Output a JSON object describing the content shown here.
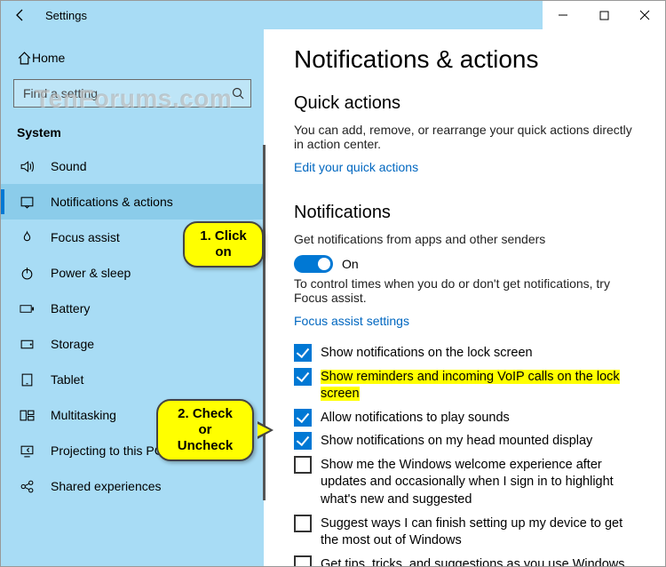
{
  "window": {
    "title": "Settings",
    "watermark": "TenForums.com"
  },
  "sidebar": {
    "home": "Home",
    "search_placeholder": "Find a setting",
    "section": "System",
    "items": [
      {
        "icon": "sound-icon",
        "label": "Sound"
      },
      {
        "icon": "notification-icon",
        "label": "Notifications & actions",
        "selected": true
      },
      {
        "icon": "focus-assist-icon",
        "label": "Focus assist"
      },
      {
        "icon": "power-icon",
        "label": "Power & sleep"
      },
      {
        "icon": "battery-icon",
        "label": "Battery"
      },
      {
        "icon": "storage-icon",
        "label": "Storage"
      },
      {
        "icon": "tablet-icon",
        "label": "Tablet"
      },
      {
        "icon": "multitasking-icon",
        "label": "Multitasking"
      },
      {
        "icon": "projecting-icon",
        "label": "Projecting to this PC"
      },
      {
        "icon": "shared-icon",
        "label": "Shared experiences"
      }
    ]
  },
  "content": {
    "h1": "Notifications & actions",
    "quick_h2": "Quick actions",
    "quick_desc": "You can add, remove, or rearrange your quick actions directly in action center.",
    "quick_link": "Edit your quick actions",
    "notif_h2": "Notifications",
    "notif_desc": "Get notifications from apps and other senders",
    "toggle_label": "On",
    "focus_note": "To control times when you do or don't get notifications, try Focus assist.",
    "focus_link": "Focus assist settings",
    "checks": [
      {
        "checked": true,
        "label": "Show notifications on the lock screen"
      },
      {
        "checked": true,
        "label": "Show reminders and incoming VoIP calls on the lock screen",
        "highlight": true
      },
      {
        "checked": true,
        "label": "Allow notifications to play sounds"
      },
      {
        "checked": true,
        "label": "Show notifications on my head mounted display"
      },
      {
        "checked": false,
        "label": "Show me the Windows welcome experience after updates and occasionally when I sign in to highlight what's new and suggested"
      },
      {
        "checked": false,
        "label": "Suggest ways I can finish setting up my device to get the most out of Windows"
      },
      {
        "checked": false,
        "label": "Get tips, tricks, and suggestions as you use Windows"
      }
    ]
  },
  "annotations": {
    "step1": "1. Click on",
    "step2": "2. Check or\nUncheck"
  }
}
